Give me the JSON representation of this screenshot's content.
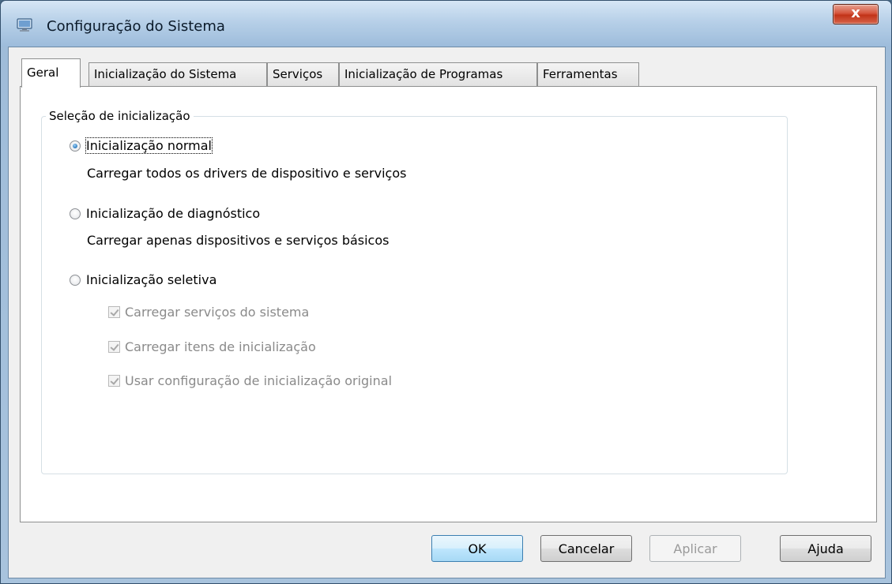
{
  "window": {
    "title": "Configuração do Sistema",
    "close_glyph": "x",
    "icon": "system-config-icon"
  },
  "tabs": [
    {
      "label": "Geral",
      "active": true
    },
    {
      "label": "Inicialização do Sistema",
      "active": false
    },
    {
      "label": "Serviços",
      "active": false
    },
    {
      "label": "Inicialização de Programas",
      "active": false
    },
    {
      "label": "Ferramentas",
      "active": false
    }
  ],
  "group": {
    "title": "Seleção de inicialização",
    "options": [
      {
        "label": "Inicialização normal",
        "description": "Carregar todos os drivers de dispositivo e serviços",
        "checked": true
      },
      {
        "label": "Inicialização de diagnóstico",
        "description": "Carregar apenas dispositivos e serviços básicos",
        "checked": false
      },
      {
        "label": "Inicialização seletiva",
        "checked": false
      }
    ],
    "checkboxes": [
      {
        "label": "Carregar serviços do sistema",
        "checked": true,
        "enabled": false
      },
      {
        "label": "Carregar itens de inicialização",
        "checked": true,
        "enabled": false
      },
      {
        "label": "Usar configuração de inicialização original",
        "checked": true,
        "enabled": false
      }
    ]
  },
  "buttons": {
    "ok": "OK",
    "cancel": "Cancelar",
    "apply": "Aplicar",
    "help": "Ajuda"
  }
}
